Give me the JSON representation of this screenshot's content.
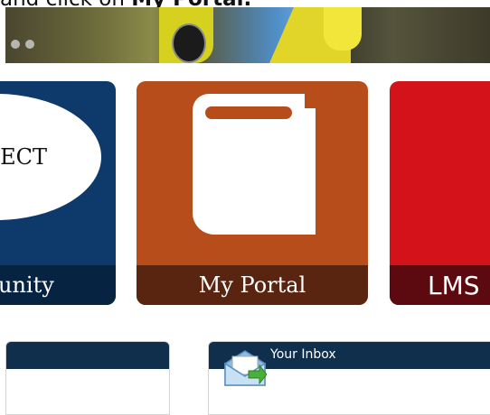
{
  "instruction": {
    "prefix": "and click on ",
    "emphasis": "My Portal."
  },
  "banner": {
    "slide_dots": 2
  },
  "tiles": [
    {
      "id": "community",
      "logo_text": "NECT",
      "caption": "unity",
      "bg": "#0e3a6b"
    },
    {
      "id": "portal",
      "caption": "My Portal",
      "icon": "book-icon",
      "bg": "#b84d1c"
    },
    {
      "id": "lms",
      "caption": "LMS",
      "bg": "#d4121a"
    }
  ],
  "panels": {
    "inbox": {
      "title": "Your Inbox",
      "icon": "mail-icon",
      "header_color": "#0f2f4d"
    }
  }
}
